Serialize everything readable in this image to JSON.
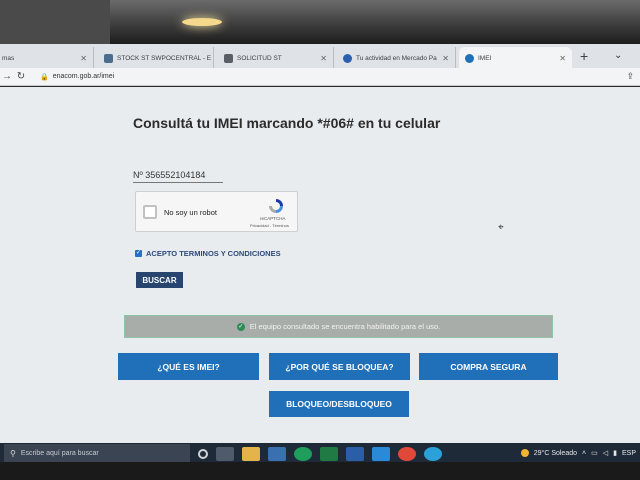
{
  "browser": {
    "tabs": [
      {
        "label": "mas",
        "active": false
      },
      {
        "label": "STOCK ST SWPOCENTRAL - E",
        "active": false
      },
      {
        "label": "SOLICITUD ST",
        "active": false
      },
      {
        "label": "Tu actividad en Mercado Pa",
        "active": false
      },
      {
        "label": "IMEI",
        "active": true
      }
    ],
    "url": "enacom.gob.ar/imei"
  },
  "page": {
    "headline": "Consultá tu IMEI marcando *#06# en tu celular",
    "imei_value": "Nº 356552104184",
    "recaptcha": {
      "label": "No soy un robot",
      "brand": "reCAPTCHA",
      "links": "Privacidad - Términos",
      "checked": false
    },
    "terms": {
      "label": "ACEPTO TERMINOS Y CONDICIONES",
      "checked": true
    },
    "search_button": "BUSCAR",
    "status_message": "El equipo consultado se encuentra habilitado para el uso.",
    "buttons": {
      "que_es_imei": "¿QUÉ ES IMEI?",
      "por_que_bloquea": "¿POR QUÉ SE BLOQUEA?",
      "compra_segura": "COMPRA SEGURA",
      "bloqueo_desbloqueo": "BLOQUEO/DESBLOQUEO"
    }
  },
  "taskbar": {
    "search_placeholder": "Escribe aquí para buscar",
    "weather": "29°C  Soleado",
    "language": "ESP"
  },
  "colors": {
    "primary_button": "#1f6fb9",
    "dark_button": "#27456f",
    "status_bar": "#a9adaa"
  }
}
